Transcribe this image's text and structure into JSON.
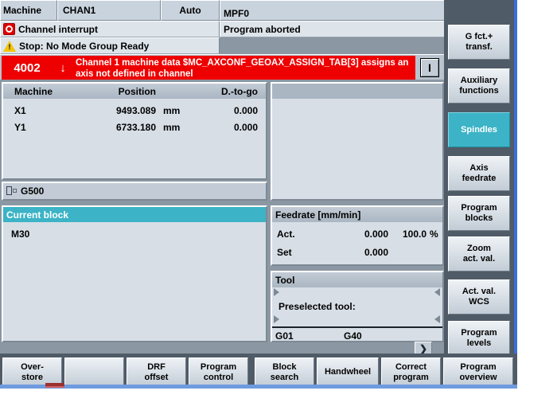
{
  "header": {
    "area_label": "Machine",
    "channel": "CHAN1",
    "mode": "Auto",
    "program": "MPF0"
  },
  "status": {
    "line1": "Channel interrupt",
    "line1_icon": "stop-circle-icon",
    "line2": "Stop: No Mode Group Ready",
    "line2_icon": "warning-triangle-icon",
    "program_state": "Program aborted"
  },
  "alarm": {
    "number": "4002",
    "arrow": "↓",
    "text": "Channel 1 machine data $MC_AXCONF_GEOAX_ASSIGN_TAB[3] assigns an axis not defined in channel",
    "indicator": "I"
  },
  "position_panel": {
    "columns": [
      "Machine",
      "Position",
      "D.-to-go"
    ],
    "rows": [
      {
        "axis": "X1",
        "position": "9493.089",
        "unit": "mm",
        "dist_to_go": "0.000"
      },
      {
        "axis": "Y1",
        "position": "6733.180",
        "unit": "mm",
        "dist_to_go": "0.000"
      }
    ]
  },
  "zero_offset": {
    "icon": "wcs-offset-icon",
    "value": "G500"
  },
  "current_block": {
    "title": "Current block",
    "lines": "M30"
  },
  "feedrate_panel": {
    "title": "Feedrate [mm/min]",
    "act_label": "Act.",
    "act_value": "0.000",
    "override": "100.0",
    "percent_sign": "%",
    "set_label": "Set",
    "set_value": "0.000"
  },
  "tool_panel": {
    "title": "Tool",
    "current_tool": "",
    "preselected_label": "Preselected tool:",
    "preselected_tool": "",
    "g_code_1": "G01",
    "g_code_2": "G40"
  },
  "chevron": {
    "label": "❯",
    "name": "expand-right-icon"
  },
  "vertical_softkeys": [
    {
      "line1": "G fct.+",
      "line2": "transf.",
      "selected": false
    },
    {
      "line1": "Auxiliary",
      "line2": "functions",
      "selected": false
    },
    {
      "line1": "Spindles",
      "line2": "",
      "selected": true
    },
    {
      "line1": "Axis",
      "line2": "feedrate",
      "selected": false
    },
    {
      "line1": "Program",
      "line2": "blocks",
      "selected": false
    },
    {
      "line1": "Zoom",
      "line2": "act. val.",
      "selected": false
    },
    {
      "line1": "Act. val.",
      "line2": "WCS",
      "selected": false
    },
    {
      "line1": "Program",
      "line2": "levels",
      "selected": false
    }
  ],
  "horizontal_softkeys": [
    {
      "line1": "Over-",
      "line2": "store"
    },
    {
      "line1": "",
      "line2": ""
    },
    {
      "line1": "DRF",
      "line2": "offset"
    },
    {
      "line1": "Program",
      "line2": "control"
    },
    {
      "line1": "Block",
      "line2": "search"
    },
    {
      "line1": "Handwheel",
      "line2": ""
    },
    {
      "line1": "Correct",
      "line2": "program"
    },
    {
      "line1": "Program",
      "line2": "overview"
    }
  ],
  "colors": {
    "alarm_red": "#ee0000",
    "accent_teal": "#3cb3c6",
    "panel_bg": "#d7dee6",
    "softkey_bar": "#505b68",
    "blue_bar": "#6e9be0"
  }
}
